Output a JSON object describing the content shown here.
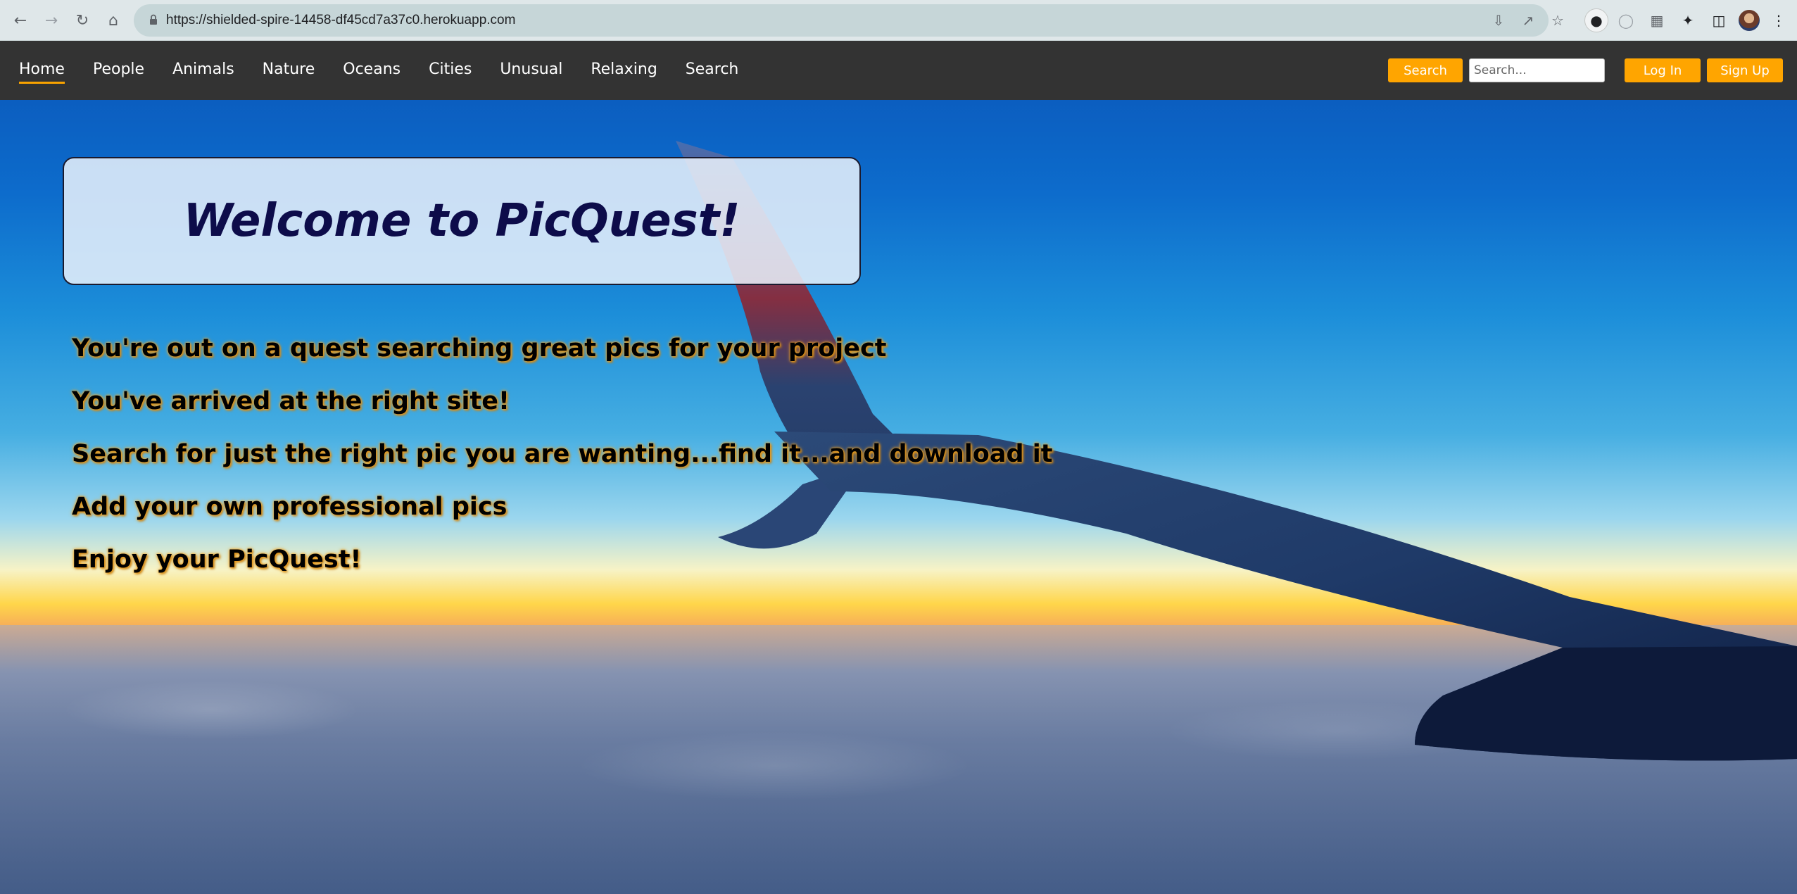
{
  "browser": {
    "url": "https://shielded-spire-14458-df45cd7a37c0.herokuapp.com",
    "icons": [
      "back-arrow-icon",
      "forward-arrow-icon",
      "reload-icon",
      "home-icon",
      "lock-icon",
      "install-icon",
      "share-icon",
      "bookmark-star-icon",
      "extension-icon",
      "puzzle-icon",
      "side-panel-icon",
      "profile-avatar",
      "menu-icon"
    ]
  },
  "site": {
    "nav": [
      "Home",
      "People",
      "Animals",
      "Nature",
      "Oceans",
      "Cities",
      "Unusual",
      "Relaxing",
      "Search"
    ],
    "active_nav": "Home",
    "search_button": "Search",
    "search_placeholder": "Search...",
    "login_button": "Log In",
    "signup_button": "Sign Up"
  },
  "hero": {
    "title": "Welcome to PicQuest!",
    "lines": [
      "You're out on a quest searching great pics for your project",
      "You've arrived at the right site!",
      "Search for just the right pic you are wanting...find it...and download it",
      "Add your own professional pics",
      "Enjoy your PicQuest!"
    ]
  },
  "colors": {
    "navbar_bg": "#333333",
    "accent_orange": "#ffa500",
    "title_color": "#0d0c4a"
  }
}
